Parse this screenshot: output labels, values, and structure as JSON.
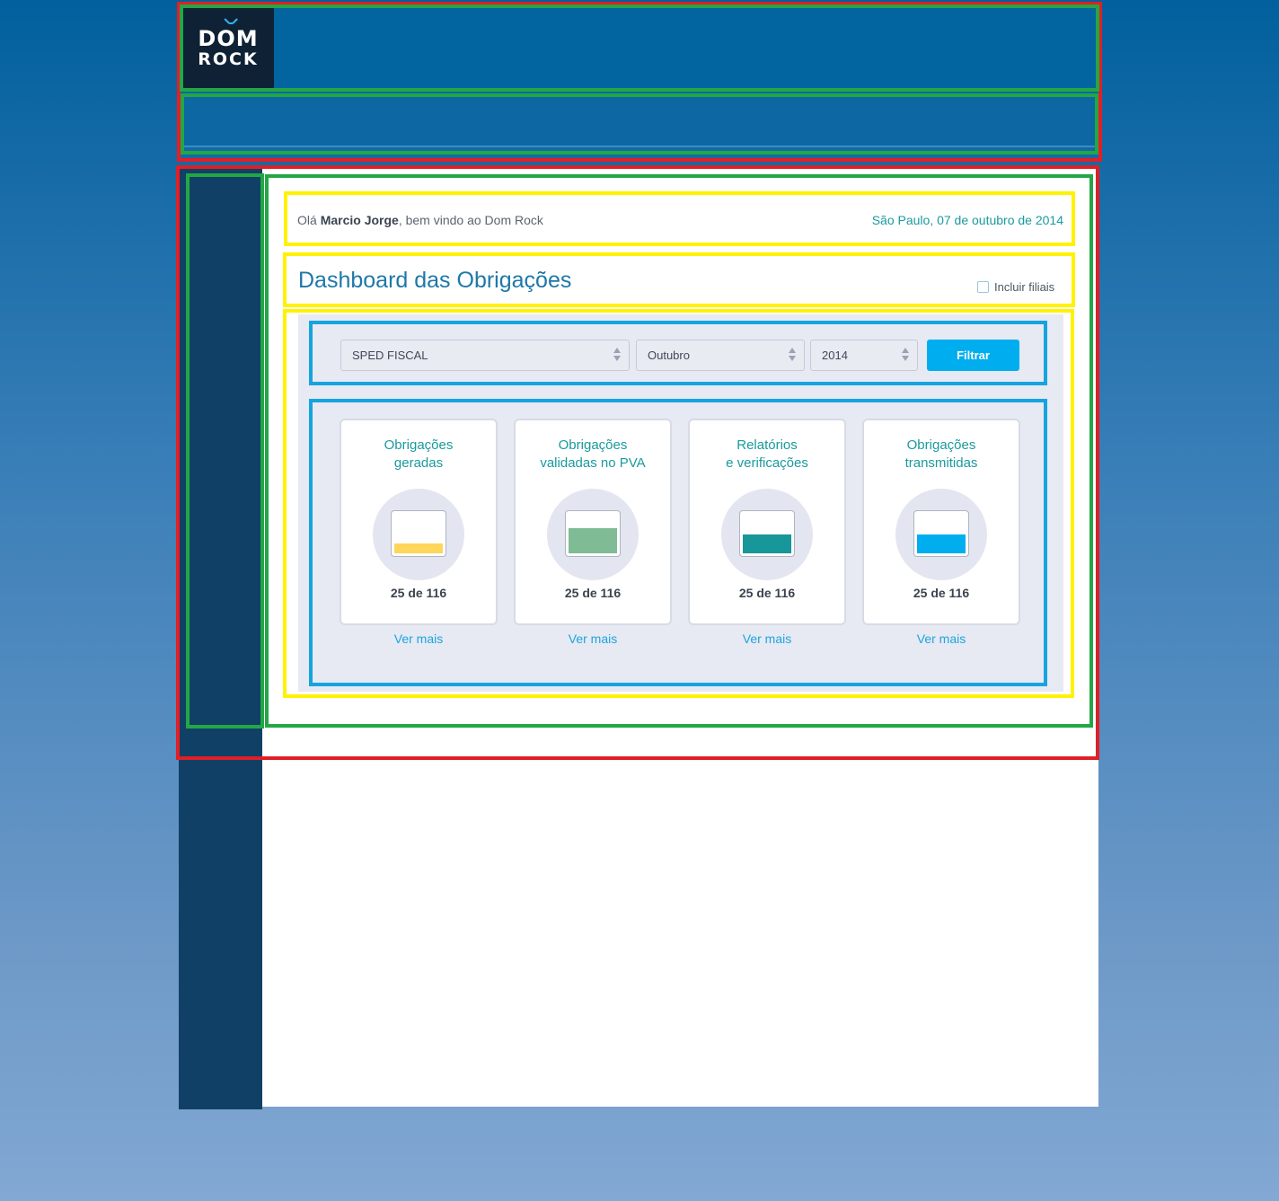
{
  "brand": {
    "logo_line1": "DOM",
    "logo_line2": "ROCK"
  },
  "welcome": {
    "prefix": "Olá ",
    "user_name": "Marcio Jorge",
    "suffix": ", bem vindo ao Dom Rock",
    "date": "São Paulo, 07 de outubro de 2014"
  },
  "page": {
    "title": "Dashboard das Obrigações",
    "include_branches_label": "Incluir filiais",
    "include_branches_checked": false
  },
  "filters": {
    "obligation_type": "SPED FISCAL",
    "month": "Outubro",
    "year": "2014",
    "submit_label": "Filtrar"
  },
  "cards": [
    {
      "title": "Obrigações\ngeradas",
      "count_text": "25 de 116",
      "fill_color": "#ffd55a",
      "link": "Ver mais",
      "fill_fraction": 0.25
    },
    {
      "title": "Obrigações\nvalidadas no PVA",
      "count_text": "25 de 116",
      "fill_color": "#7fbb95",
      "link": "Ver mais",
      "fill_fraction": 0.6
    },
    {
      "title": "Relatórios\ne verificações",
      "count_text": "25 de 116",
      "fill_color": "#17979a",
      "link": "Ver mais",
      "fill_fraction": 0.45
    },
    {
      "title": "Obrigações\ntransmitidas",
      "count_text": "25 de 116",
      "fill_color": "#00aeef",
      "link": "Ver mais",
      "fill_fraction": 0.45
    }
  ],
  "colors": {
    "header_bg": "#02659f",
    "sidebar_bg": "#114066",
    "accent_teal": "#1a9a9d",
    "accent_blue": "#00aeef"
  }
}
